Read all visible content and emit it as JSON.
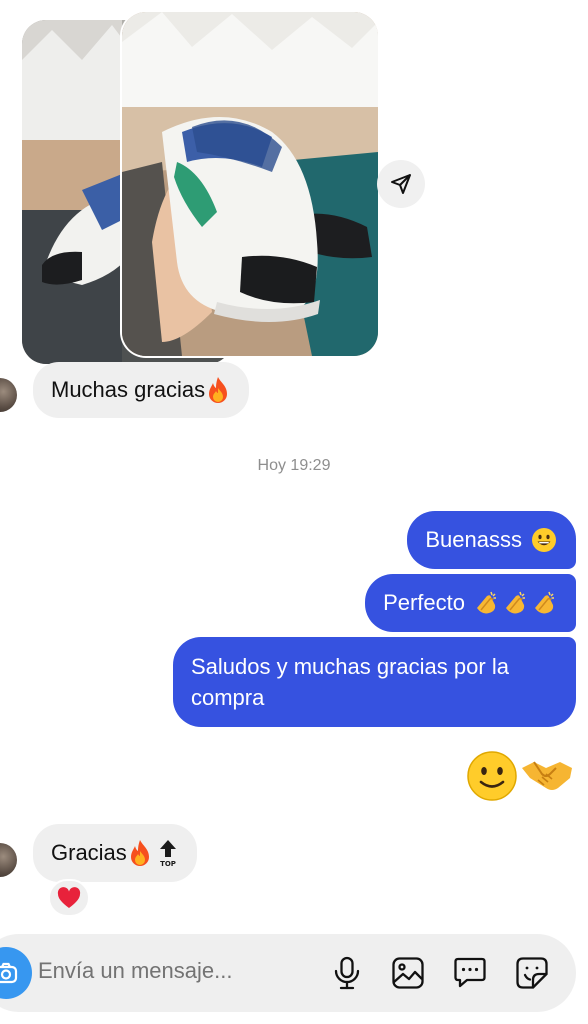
{
  "conversation": {
    "photo_message": {
      "images": [
        "shoe-photo-1",
        "shoe-photo-2"
      ],
      "share_icon": "send-icon"
    },
    "messages_in": [
      {
        "text": "Muchas gracias",
        "emoji": "fire"
      },
      {
        "text": "Gracias",
        "emoji": "fire, top-arrow",
        "reaction": "red-heart"
      }
    ],
    "timestamp": "Hoy 19:29",
    "messages_out": [
      {
        "text": "Buenasss",
        "emoji": "grinning-face"
      },
      {
        "text": "Perfecto",
        "emoji": "clapping-hands x3"
      },
      {
        "text": "Saludos y muchas gracias por la compra"
      }
    ],
    "emoji_message": [
      "slightly-smiling-face",
      "handshake"
    ]
  },
  "composer": {
    "placeholder": "Envía un mensaje...",
    "icons": [
      "camera-icon",
      "microphone-icon",
      "gallery-icon",
      "chat-bubble-icon",
      "sticker-icon"
    ]
  },
  "colors": {
    "outgoing_bubble": "#3652e0",
    "incoming_bubble": "#efefef",
    "camera_button": "#3797f0"
  }
}
